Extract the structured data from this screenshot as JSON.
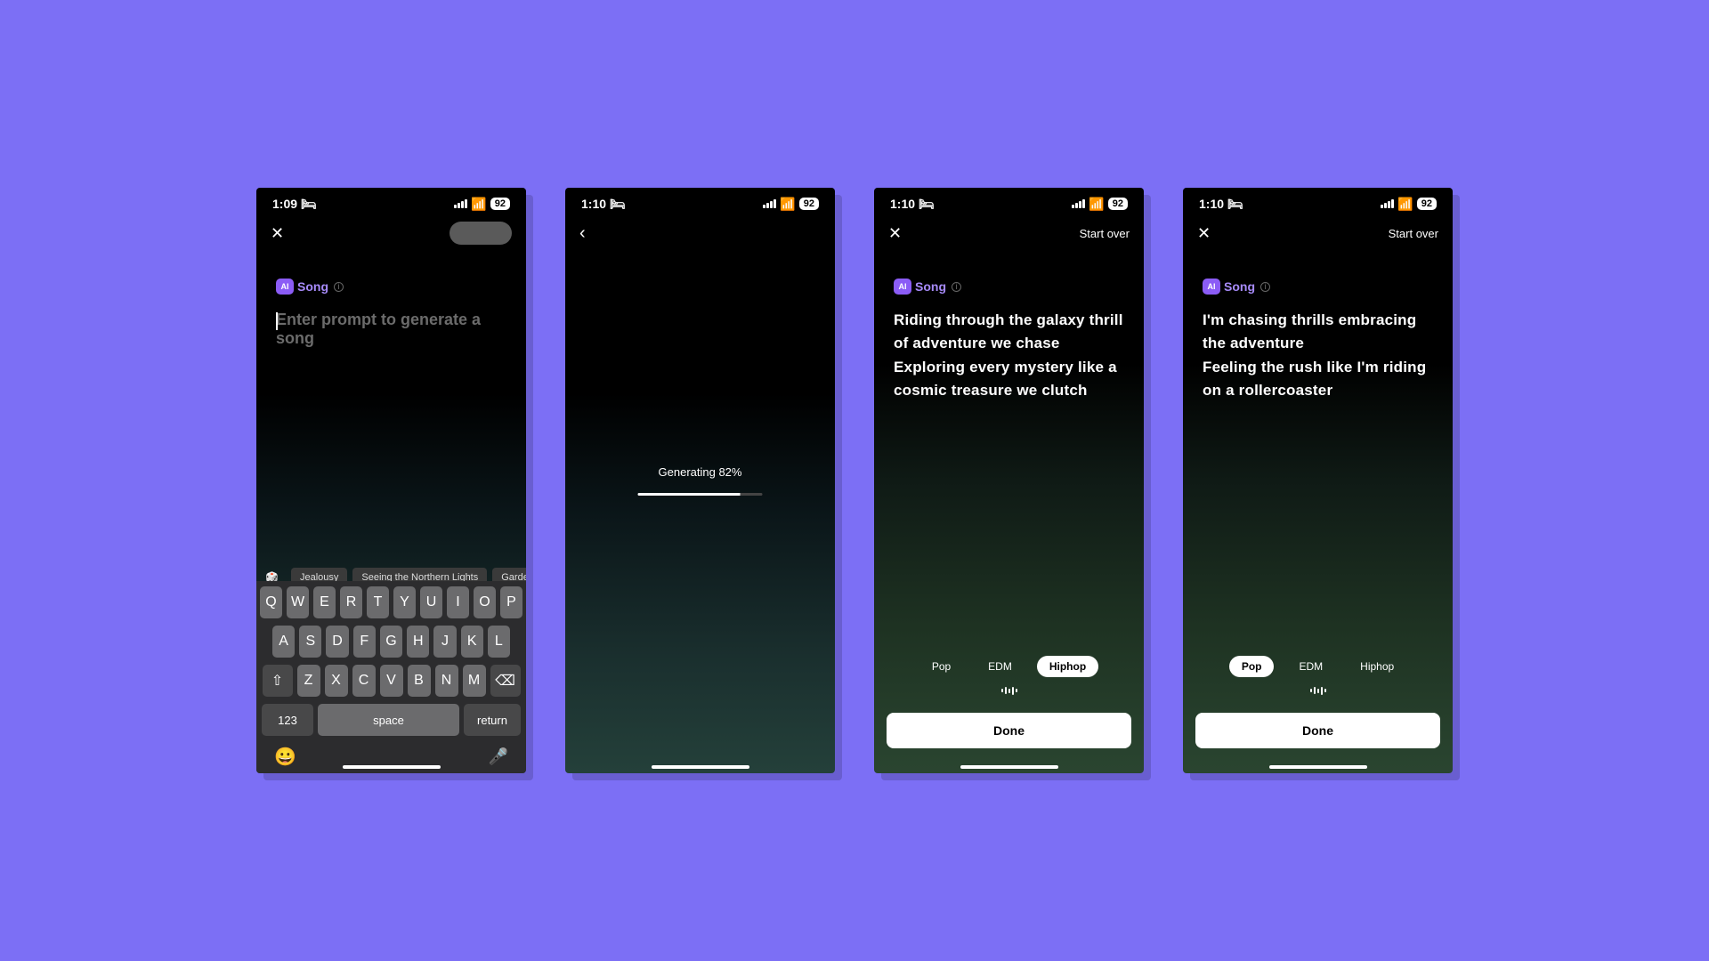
{
  "status": {
    "time1": "1:09",
    "time2": "1:10",
    "battery": "92"
  },
  "nav": {
    "close": "✕",
    "back": "‹",
    "start_over": "Start over"
  },
  "brand": {
    "ai": "AI",
    "song": "Song",
    "info": "i"
  },
  "screen1": {
    "placeholder": "Enter prompt to generate a song",
    "chips": [
      "Jealousy",
      "Seeing the Northern Lights",
      "Gardening with"
    ]
  },
  "screen2": {
    "generating": "Generating 82%",
    "progress": 82
  },
  "screen3": {
    "lyrics": "Riding through the galaxy thrill of adventure we chase\nExploring every mystery like a cosmic treasure we clutch",
    "genres": [
      "Pop",
      "EDM",
      "Hiphop"
    ],
    "active": "Hiphop"
  },
  "screen4": {
    "lyrics": "I'm chasing thrills embracing the adventure\nFeeling the rush like I'm riding on a rollercoaster",
    "genres": [
      "Pop",
      "EDM",
      "Hiphop"
    ],
    "active": "Pop"
  },
  "done": "Done",
  "keyboard": {
    "row1": [
      "Q",
      "W",
      "E",
      "R",
      "T",
      "Y",
      "U",
      "I",
      "O",
      "P"
    ],
    "row2": [
      "A",
      "S",
      "D",
      "F",
      "G",
      "H",
      "J",
      "K",
      "L"
    ],
    "row3": [
      "Z",
      "X",
      "C",
      "V",
      "B",
      "N",
      "M"
    ],
    "shift": "⇧",
    "del": "⌫",
    "num": "123",
    "space": "space",
    "return": "return",
    "emoji": "😀",
    "mic": "🎤"
  }
}
